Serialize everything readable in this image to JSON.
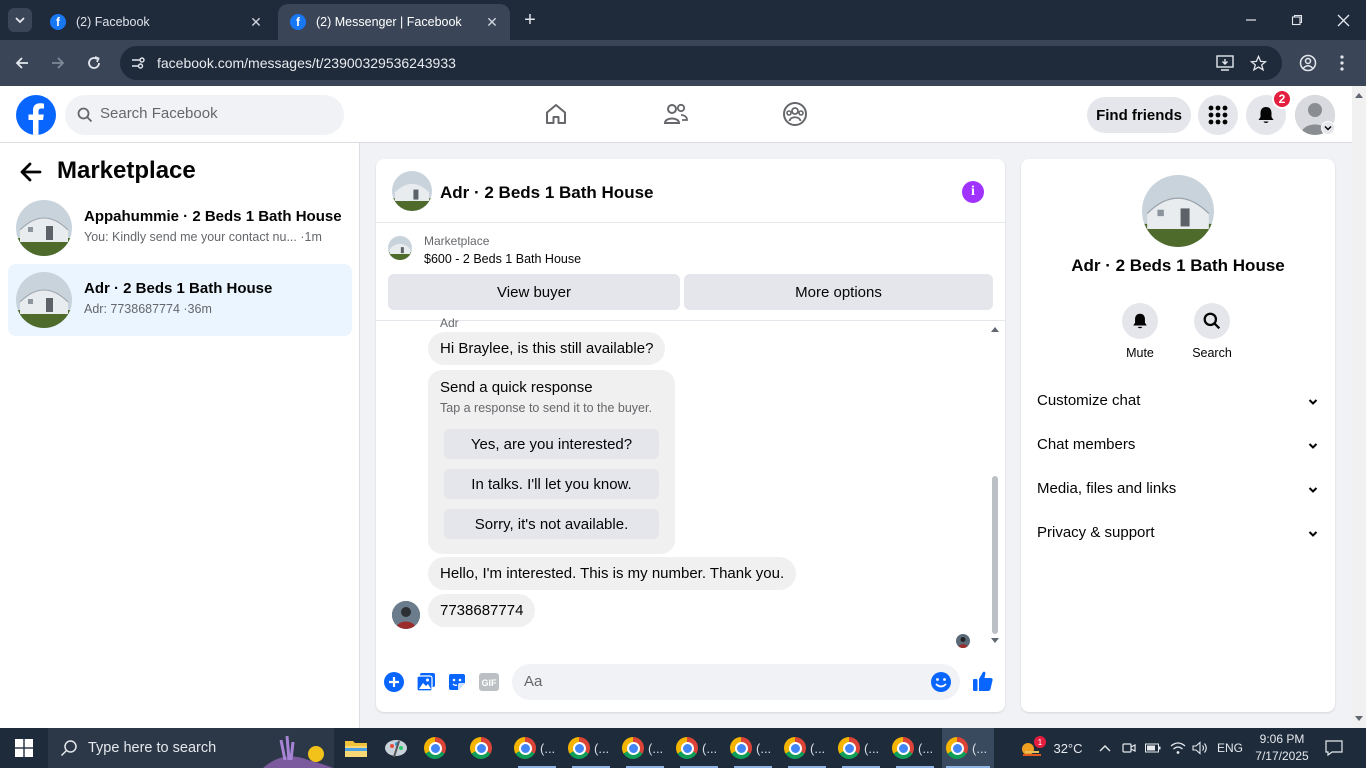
{
  "browser": {
    "tabs": [
      {
        "title": "(2) Facebook"
      },
      {
        "title": "(2) Messenger | Facebook"
      }
    ],
    "url": "facebook.com/messages/t/23900329536243933"
  },
  "fb": {
    "search_placeholder": "Search Facebook",
    "find_friends": "Find friends",
    "notification_count": "2"
  },
  "sidebar": {
    "title": "Marketplace",
    "conversations": [
      {
        "name": "Appahummie · 2 Beds 1 Bath House",
        "preview": "You: Kindly send me your contact nu... ·1m"
      },
      {
        "name": "Adr · 2 Beds 1 Bath House",
        "preview": "Adr: 7738687774 ·36m"
      }
    ]
  },
  "chat": {
    "title": "Adr · 2 Beds 1 Bath House",
    "marketplace_label": "Marketplace",
    "listing": "$600 - 2 Beds 1 Bath House",
    "view_buyer": "View buyer",
    "more_options": "More options",
    "sender": "Adr",
    "messages": [
      "Hi Braylee, is this still available?",
      "Hello, I'm interested. This is my number. Thank you.",
      "7738687774"
    ],
    "quick_response": {
      "title": "Send a quick response",
      "subtitle": "Tap a response to send it to the buyer.",
      "options": [
        "Yes, are you interested?",
        "In talks. I'll let you know.",
        "Sorry, it's not available."
      ]
    },
    "composer_placeholder": "Aa"
  },
  "info_panel": {
    "name": "Adr · 2 Beds 1 Bath House",
    "actions": [
      {
        "label": "Mute"
      },
      {
        "label": "Search"
      }
    ],
    "sections": [
      "Customize chat",
      "Chat members",
      "Media, files and links",
      "Privacy & support"
    ]
  },
  "taskbar": {
    "search_text": "Type here to search",
    "app_ellipsis": "(...",
    "weather": "32°C",
    "weather_badge": "1",
    "lang": "ENG",
    "time": "9:06 PM",
    "date": "7/17/2025"
  },
  "colors": {
    "fb_blue": "#0866ff",
    "accent_purple": "#a033ff",
    "badge_red": "#e41e3f"
  }
}
